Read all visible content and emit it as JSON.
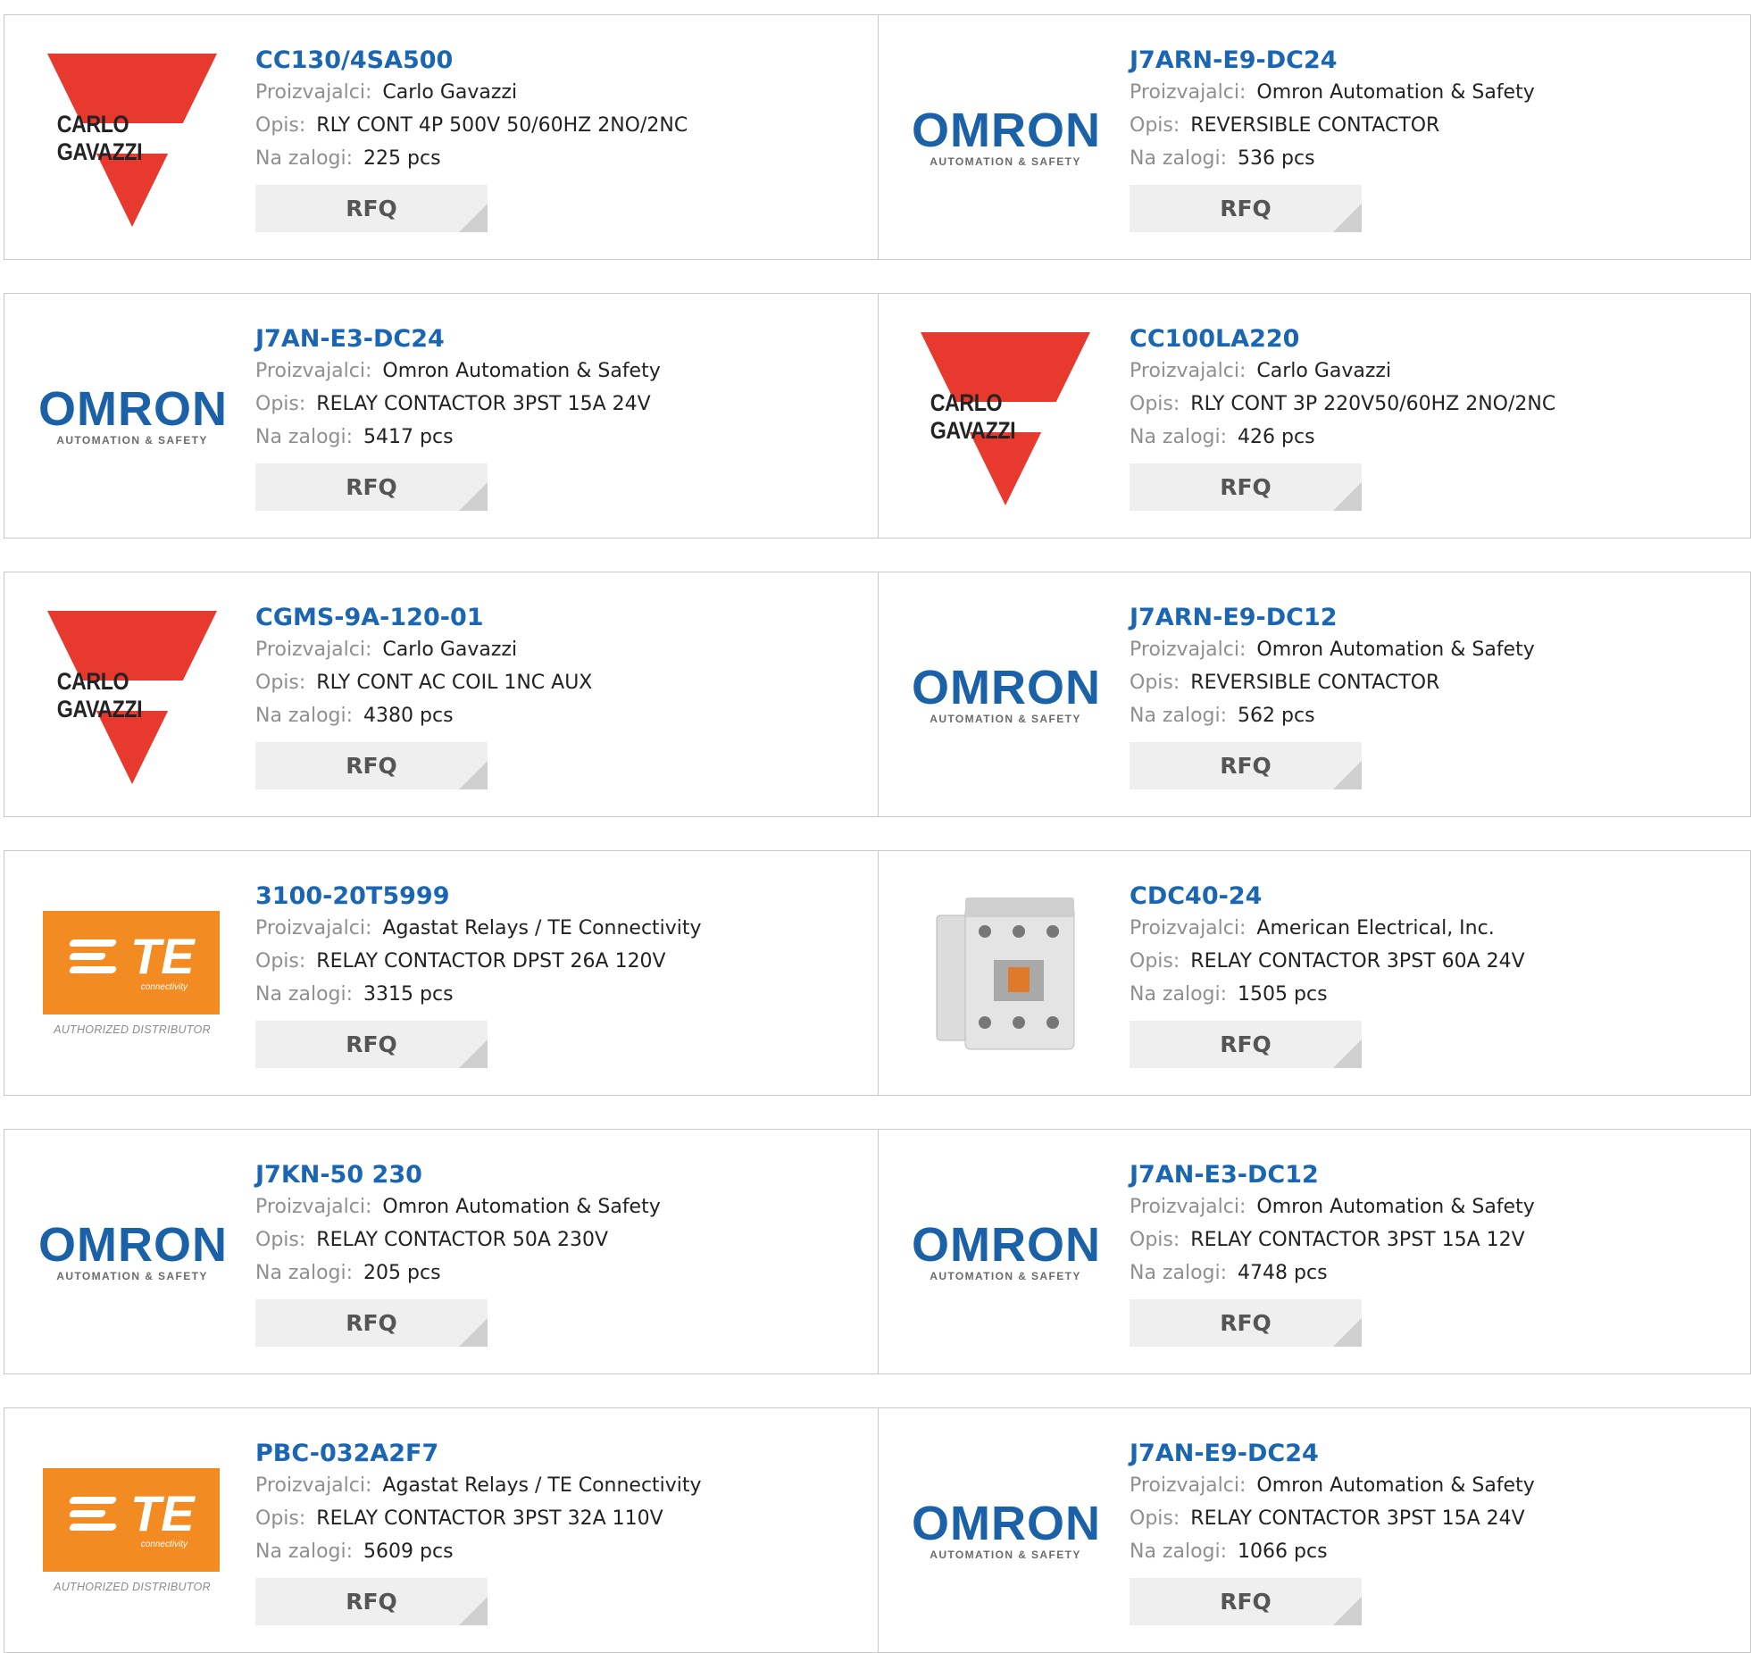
{
  "labels": {
    "manufacturer": "Proizvajalci:",
    "description": "Opis:",
    "stock": "Na zalogi:",
    "rfq": "RFQ"
  },
  "logos": {
    "carlo_gavazzi": {
      "text": "CARLO GAVAZZI",
      "color": "#e8392f"
    },
    "omron": {
      "word": "OMRON",
      "sub": "AUTOMATION & SAFETY",
      "color": "#1a61a8"
    },
    "te": {
      "word": "TE",
      "sub": "connectivity",
      "tagline": "AUTHORIZED DISTRIBUTOR",
      "color": "#f28c22"
    }
  },
  "products": [
    {
      "part": "CC130/4SA500",
      "logo": "carlo_gavazzi",
      "manufacturer": "Carlo Gavazzi",
      "description": "RLY CONT 4P 500V 50/60HZ 2NO/2NC",
      "stock": "225 pcs"
    },
    {
      "part": "J7ARN-E9-DC24",
      "logo": "omron",
      "manufacturer": "Omron Automation & Safety",
      "description": "REVERSIBLE CONTACTOR",
      "stock": "536 pcs"
    },
    {
      "part": "J7AN-E3-DC24",
      "logo": "omron",
      "manufacturer": "Omron Automation & Safety",
      "description": "RELAY CONTACTOR 3PST 15A 24V",
      "stock": "5417 pcs"
    },
    {
      "part": "CC100LA220",
      "logo": "carlo_gavazzi",
      "manufacturer": "Carlo Gavazzi",
      "description": "RLY CONT 3P 220V50/60HZ 2NO/2NC",
      "stock": "426 pcs"
    },
    {
      "part": "CGMS-9A-120-01",
      "logo": "carlo_gavazzi",
      "manufacturer": "Carlo Gavazzi",
      "description": "RLY CONT AC COIL 1NC AUX",
      "stock": "4380 pcs"
    },
    {
      "part": "J7ARN-E9-DC12",
      "logo": "omron",
      "manufacturer": "Omron Automation & Safety",
      "description": "REVERSIBLE CONTACTOR",
      "stock": "562 pcs"
    },
    {
      "part": "3100-20T5999",
      "logo": "te",
      "manufacturer": "Agastat Relays / TE Connectivity",
      "description": "RELAY CONTACTOR DPST 26A 120V",
      "stock": "3315 pcs"
    },
    {
      "part": "CDC40-24",
      "logo": "contactor_photo",
      "manufacturer": "American Electrical, Inc.",
      "description": "RELAY CONTACTOR 3PST 60A 24V",
      "stock": "1505 pcs"
    },
    {
      "part": "J7KN-50 230",
      "logo": "omron",
      "manufacturer": "Omron Automation & Safety",
      "description": "RELAY CONTACTOR 50A 230V",
      "stock": "205 pcs"
    },
    {
      "part": "J7AN-E3-DC12",
      "logo": "omron",
      "manufacturer": "Omron Automation & Safety",
      "description": "RELAY CONTACTOR 3PST 15A 12V",
      "stock": "4748 pcs"
    },
    {
      "part": "PBC-032A2F7",
      "logo": "te",
      "manufacturer": "Agastat Relays / TE Connectivity",
      "description": "RELAY CONTACTOR 3PST 32A 110V",
      "stock": "5609 pcs"
    },
    {
      "part": "J7AN-E9-DC24",
      "logo": "omron",
      "manufacturer": "Omron Automation & Safety",
      "description": "RELAY CONTACTOR 3PST 15A 24V",
      "stock": "1066 pcs"
    }
  ]
}
